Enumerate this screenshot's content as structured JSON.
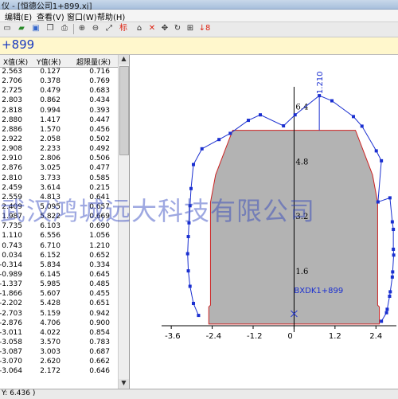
{
  "window": {
    "title": "仪 - [恒德公司1+899.xj]"
  },
  "menu": [
    "编辑(E)",
    "查看(V)",
    "窗口(W)",
    "帮助(H)"
  ],
  "toolbar": {
    "tag_label": "标",
    "zoom_label": "↓8"
  },
  "mileage_display": "+899",
  "table": {
    "headers": [
      "X值(米)",
      "Y值(米)",
      "超限量(米)"
    ],
    "rows": [
      [
        "2.563",
        "0.127",
        "0.716"
      ],
      [
        "2.706",
        "0.378",
        "0.769"
      ],
      [
        "2.725",
        "0.479",
        "0.683"
      ],
      [
        "2.803",
        "0.862",
        "0.434"
      ],
      [
        "2.818",
        "0.994",
        "0.393"
      ],
      [
        "2.880",
        "1.417",
        "0.447"
      ],
      [
        "2.886",
        "1.570",
        "0.456"
      ],
      [
        "2.922",
        "2.058",
        "0.502"
      ],
      [
        "2.908",
        "2.233",
        "0.492"
      ],
      [
        "2.910",
        "2.806",
        "0.506"
      ],
      [
        "2.876",
        "3.025",
        "0.477"
      ],
      [
        "2.810",
        "3.733",
        "0.585"
      ],
      [
        "2.459",
        "3.614",
        "0.215"
      ],
      [
        "2.559",
        "4.813",
        "0.641"
      ],
      [
        "2.409",
        "5.095",
        "0.657"
      ],
      [
        "1.987",
        "5.822",
        "0.669"
      ],
      [
        "7.735",
        "6.103",
        "0.690"
      ],
      [
        "1.110",
        "6.556",
        "1.056"
      ],
      [
        "0.743",
        "6.710",
        "1.210"
      ],
      [
        "0.034",
        "6.152",
        "0.652"
      ],
      [
        "-0.314",
        "5.834",
        "0.334"
      ],
      [
        "-0.989",
        "6.145",
        "0.645"
      ],
      [
        "-1.337",
        "5.985",
        "0.485"
      ],
      [
        "-1.866",
        "5.607",
        "0.455"
      ],
      [
        "-2.202",
        "5.428",
        "0.651"
      ],
      [
        "-2.703",
        "5.159",
        "0.942"
      ],
      [
        "-2.876",
        "4.706",
        "0.900"
      ],
      [
        "-3.011",
        "4.022",
        "0.854"
      ],
      [
        "-3.058",
        "3.570",
        "0.783"
      ],
      [
        "-3.087",
        "3.003",
        "0.687"
      ],
      [
        "-3.070",
        "2.620",
        "0.662"
      ],
      [
        "-3.064",
        "2.172",
        "0.646"
      ]
    ]
  },
  "chart_data": {
    "type": "scatter",
    "x_ticks": [
      "-3.6",
      "-2.4",
      "-1.2",
      "0",
      "1.2",
      "2.4"
    ],
    "y_ticks": [
      "1.6",
      "3.2",
      "4.8",
      "6.4"
    ],
    "x_range": [
      -4.0,
      3.0
    ],
    "y_range": [
      0,
      7.2
    ],
    "annotation_max": "1.210",
    "point_label": "BXDK1+899",
    "series": [
      {
        "name": "scan",
        "values": [
          [
            -2.8,
            0.3
          ],
          [
            -2.95,
            0.65
          ],
          [
            -3.05,
            1.15
          ],
          [
            -3.1,
            1.6
          ],
          [
            -3.12,
            2.1
          ],
          [
            -3.1,
            2.6
          ],
          [
            -3.08,
            3.0
          ],
          [
            -3.05,
            3.5
          ],
          [
            -3.02,
            4.0
          ],
          [
            -2.95,
            4.7
          ],
          [
            -2.7,
            5.16
          ],
          [
            -2.2,
            5.43
          ],
          [
            -1.87,
            5.61
          ],
          [
            -1.34,
            5.99
          ],
          [
            -0.99,
            6.15
          ],
          [
            -0.31,
            5.83
          ],
          [
            0.03,
            6.15
          ],
          [
            0.74,
            6.71
          ],
          [
            1.11,
            6.56
          ],
          [
            1.74,
            6.1
          ],
          [
            1.99,
            5.82
          ],
          [
            2.41,
            5.1
          ],
          [
            2.56,
            4.81
          ],
          [
            2.46,
            3.61
          ],
          [
            2.81,
            3.73
          ],
          [
            2.88,
            3.03
          ],
          [
            2.91,
            2.81
          ],
          [
            2.91,
            2.23
          ],
          [
            2.92,
            2.06
          ],
          [
            2.89,
            1.57
          ],
          [
            2.88,
            1.42
          ],
          [
            2.82,
            0.99
          ],
          [
            2.8,
            0.86
          ],
          [
            2.73,
            0.48
          ],
          [
            2.71,
            0.38
          ],
          [
            2.56,
            0.13
          ]
        ]
      },
      {
        "name": "clearance",
        "values": [
          [
            -2.5,
            0.05
          ],
          [
            -2.5,
            0.55
          ],
          [
            -2.45,
            0.6
          ],
          [
            -2.45,
            3.6
          ],
          [
            -2.3,
            4.4
          ],
          [
            -1.8,
            5.7
          ],
          [
            1.8,
            5.7
          ],
          [
            2.3,
            4.4
          ],
          [
            2.45,
            3.6
          ],
          [
            2.45,
            0.6
          ],
          [
            2.5,
            0.55
          ],
          [
            2.5,
            0.05
          ]
        ]
      }
    ]
  },
  "watermark": "武汉鸿城远大科技有限公司",
  "status": "Y: 6.436 )"
}
